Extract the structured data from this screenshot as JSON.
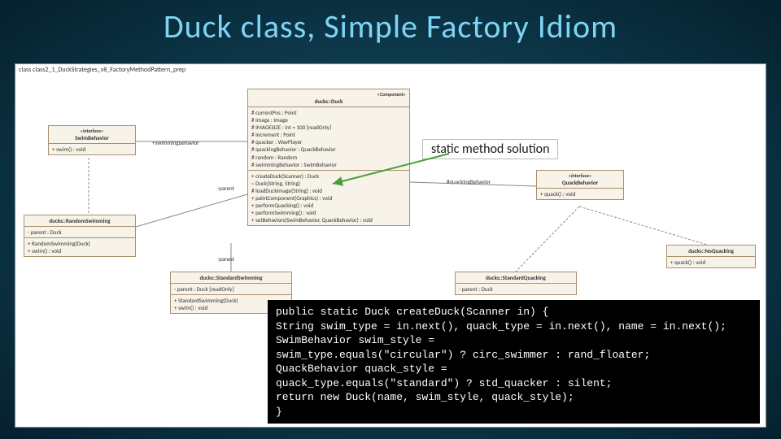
{
  "title": "Duck class, Simple Factory Idiom",
  "package_label": "class class2_1_DuckStrategies_v8_FactoryMethodPattern_prep",
  "annotation": {
    "text": "static method solution"
  },
  "component_stereotype": "«Component»",
  "relation_labels": {
    "swimming": "+swimmingBehavior",
    "quacking": "#quackingBehavior",
    "parent": "-parent"
  },
  "classes": {
    "swimBehavior": {
      "stereotype": "«interface»",
      "name": "SwimBehavior",
      "ops": [
        "+ swim() : void"
      ]
    },
    "quackBehavior": {
      "stereotype": "«interface»",
      "name": "QuackBehavior",
      "ops": [
        "+ quack() : void"
      ]
    },
    "duck": {
      "name": "ducks::Duck",
      "attrs": [
        "# currentPos : Point",
        "# image : Image",
        "# IMAGESIZE : int = 100 {readOnly}",
        "# increment : Point",
        "# quacker : WavPlayer",
        "# quackingBehavior : QuackBehavior",
        "# random : Random",
        "# swimmingBehavior : SwimBehavior"
      ],
      "ops": [
        "+ createDuck(Scanner) : Duck",
        "~ Duck(String, String)",
        "# loadDuckImage(String) : void",
        "+ paintComponent(Graphics) : void",
        "+ performQuacking() : void",
        "+ performSwimming() : void",
        "+ setBehaviors(SwimBehavior, QuackBehavior) : void"
      ]
    },
    "randomSwimming": {
      "name": "ducks::RandomSwimming",
      "attrs": [
        "- parent : Duck"
      ],
      "ops": [
        "+ RandomSwimming(Duck)",
        "+ swim() : void"
      ]
    },
    "standardSwimming": {
      "name": "ducks::StandardSwimming",
      "attrs": [
        "- parent : Duck {readOnly}"
      ],
      "ops": [
        "+ StandardSwimming(Duck)",
        "+ swim() : void"
      ]
    },
    "standardQuacking": {
      "name": "ducks::StandardQuacking",
      "attrs": [
        "- parent : Duck"
      ],
      "ops": []
    },
    "noQuacking": {
      "name": "ducks::NoQuacking",
      "ops": [
        "+ quack() : void"
      ]
    }
  },
  "code": {
    "l1": "public static Duck createDuck(Scanner in) {",
    "l2": "    String swim_type = in.next(), quack_type = in.next(), name = in.next();",
    "l3": "    SwimBehavior swim_style =",
    "l4": "        swim_type.equals(\"circular\") ? circ_swimmer : rand_floater;",
    "l5": "    QuackBehavior quack_style =",
    "l6": "        quack_type.equals(\"standard\") ? std_quacker : silent;",
    "l7": "    return new Duck(name, swim_style, quack_style);",
    "l8": "}"
  }
}
